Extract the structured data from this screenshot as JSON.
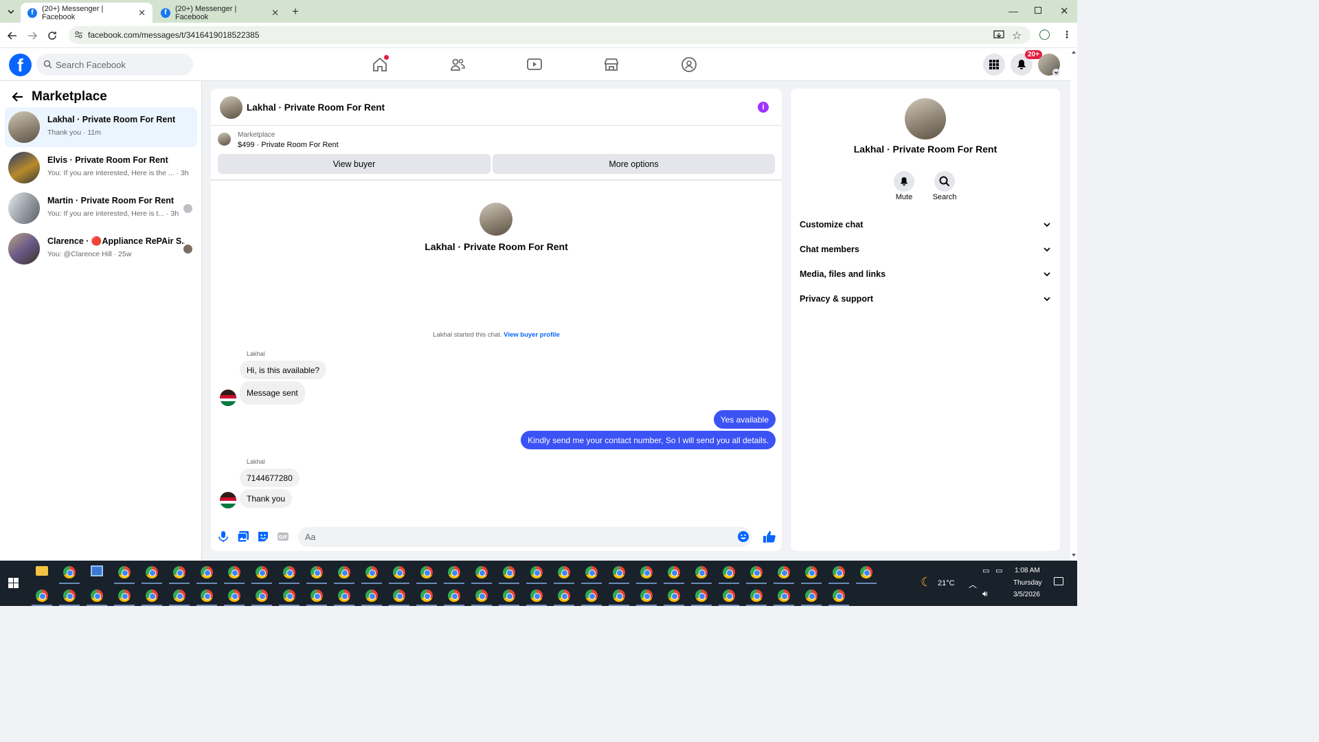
{
  "browser": {
    "tabs": [
      {
        "title": "(20+) Messenger | Facebook",
        "active": true
      },
      {
        "title": "(20+) Messenger | Facebook",
        "active": false
      }
    ],
    "url": "facebook.com/messages/t/3416419018522385"
  },
  "header": {
    "search_placeholder": "Search Facebook",
    "notification_badge": "20+"
  },
  "sidebar": {
    "title": "Marketplace",
    "conversations": [
      {
        "name": "Lakhal · Private Room For Rent",
        "preview": "Thank you · 11m",
        "active": true
      },
      {
        "name": "Elvis · Private Room For Rent",
        "preview": "You: If you are interested, Here is the ... · 3h"
      },
      {
        "name": "Martin · Private Room For Rent",
        "preview": "You: If you are interested, Here is t... · 3h"
      },
      {
        "name": "Clarence · 🔴Appliance RePAir S...",
        "preview": "You: @Clarence Hill · 25w"
      }
    ]
  },
  "chat": {
    "title": "Lakhal · Private Room For Rent",
    "marketplace_label": "Marketplace",
    "listing": "$499 · Private Room For Rent",
    "view_buyer": "View buyer",
    "more_options": "More options",
    "center_name": "Lakhal · Private Room For Rent",
    "started_text": "Lakhal started this chat.",
    "view_buyer_profile": "View buyer profile",
    "sender1": "Lakhal",
    "msg1": "Hi, is this available?",
    "msg2": "Message sent",
    "out1": "Yes available",
    "out2": "Kindly send me your contact number, So I will send you all details.",
    "sender2": "Lakhal",
    "msg3": "7144677280",
    "msg4": "Thank you",
    "composer_placeholder": "Aa"
  },
  "details": {
    "name": "Lakhal · Private Room For Rent",
    "mute": "Mute",
    "search": "Search",
    "sections": [
      "Customize chat",
      "Chat members",
      "Media, files and links",
      "Privacy & support"
    ]
  },
  "taskbar": {
    "weather": "21°C",
    "time": "1:08 AM",
    "day": "Thursday",
    "date": "3/5/2026"
  },
  "colors": {
    "fb_blue": "#0866ff",
    "outgoing_bubble": "#3b52f4",
    "info_purple": "#a033ff"
  }
}
